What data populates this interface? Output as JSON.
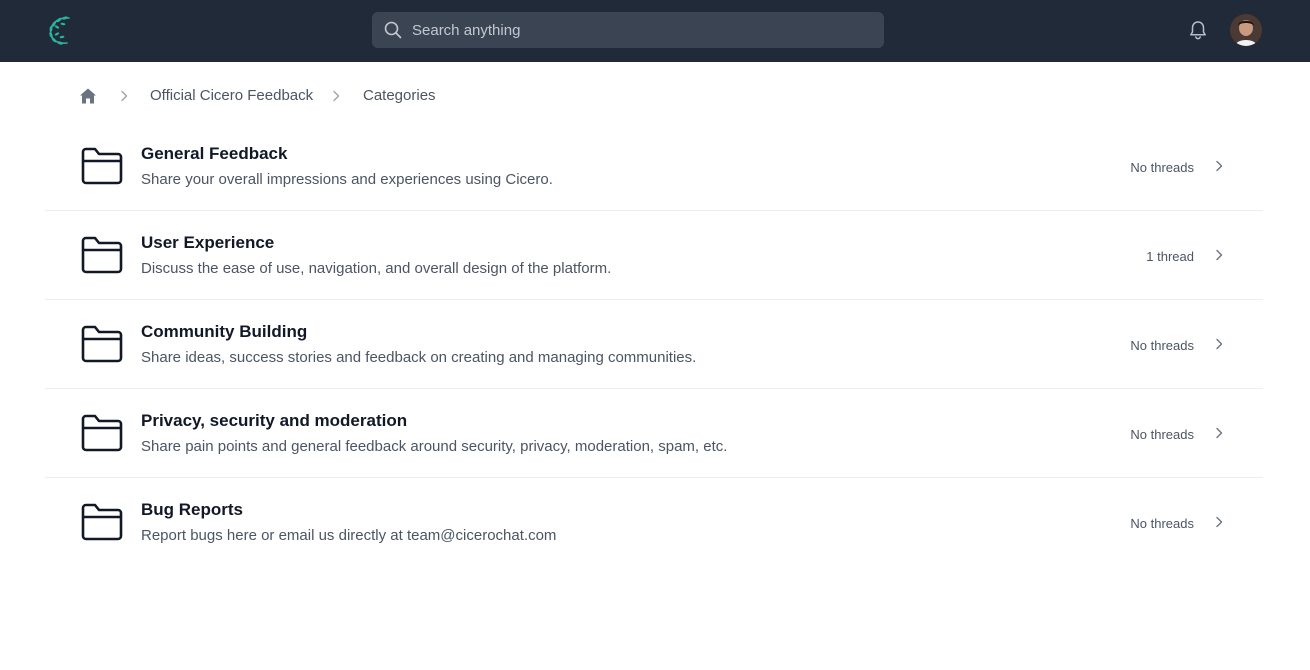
{
  "header": {
    "logo_icon": "laurel-wreath-logo",
    "search": {
      "placeholder": "Search anything",
      "value": ""
    },
    "notifications_icon": "bell-icon",
    "avatar_icon": "user-avatar"
  },
  "breadcrumb": {
    "home_icon": "home-icon",
    "items": [
      {
        "label": "Official Cicero Feedback"
      },
      {
        "label": "Categories"
      }
    ]
  },
  "categories": [
    {
      "title": "General Feedback",
      "description": "Share your overall impressions and experiences using Cicero.",
      "count": "No threads"
    },
    {
      "title": "User Experience",
      "description": "Discuss the ease of use, navigation, and overall design of the platform.",
      "count": "1 thread"
    },
    {
      "title": "Community Building",
      "description": "Share ideas, success stories and feedback on creating and managing communities.",
      "count": "No threads"
    },
    {
      "title": "Privacy, security and moderation",
      "description": "Share pain points and general feedback around security, privacy, moderation, spam, etc.",
      "count": "No threads"
    },
    {
      "title": "Bug Reports",
      "description": "Report bugs here or email us directly at team@cicerochat.com",
      "count": "No threads"
    }
  ],
  "colors": {
    "header_bg": "#212a38",
    "search_bg": "#3a4453",
    "logo_accent": "#2bb3a0",
    "text_primary": "#111827",
    "text_secondary": "#4b5563",
    "divider": "#eceef1"
  }
}
